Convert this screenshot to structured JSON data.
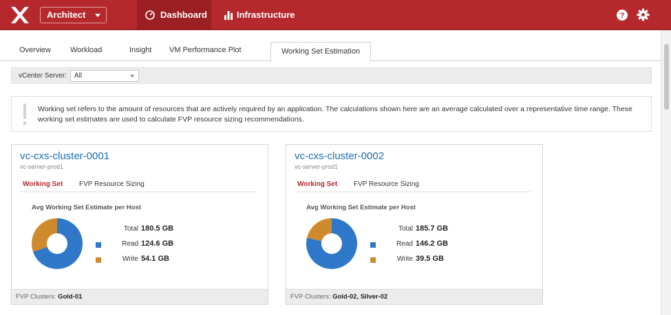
{
  "header": {
    "product": "Architect",
    "nav": [
      {
        "label": "Dashboard",
        "icon": "dashboard-gauge-icon",
        "active": true
      },
      {
        "label": "Infrastructure",
        "icon": "bar-chart-icon",
        "active": false
      }
    ],
    "brand_color": "#b5282c"
  },
  "tabs": [
    {
      "label": "Overview"
    },
    {
      "label": "Workload"
    },
    {
      "label": "Insight"
    },
    {
      "label": "VM Performance Plot"
    },
    {
      "label": "Working Set Estimation",
      "active": true
    }
  ],
  "filter": {
    "label": "vCenter Server:",
    "value": "All"
  },
  "info": {
    "text": "Working set refers to the amount of resources that are actively required by an application. The calculations shown here are an average calculated over a representative time range. These working set estimates are used to calculate FVP resource sizing recommendations."
  },
  "colors": {
    "read": "#2f78c9",
    "write": "#cf8a2e"
  },
  "clusters": [
    {
      "name": "vc-cxs-cluster-0001",
      "server": "vc-server-prod1",
      "tab_active": "Working Set",
      "tab_other": "FVP Resource Sizing",
      "chart_title": "Avg Working Set Estimate per Host",
      "total_label": "Total",
      "total": "180.5 GB",
      "read_label": "Read",
      "read": "124.6 GB",
      "write_label": "Write",
      "write": "54.1 GB",
      "read_gb": 124.6,
      "write_gb": 54.1,
      "footer_label": "FVP Clusters:",
      "footer_value": "Gold-01"
    },
    {
      "name": "vc-cxs-cluster-0002",
      "server": "vc-server-prod1",
      "tab_active": "Working Set",
      "tab_other": "FVP Resource Sizing",
      "chart_title": "Avg Working Set Estimate per Host",
      "total_label": "Total",
      "total": "185.7 GB",
      "read_label": "Read",
      "read": "146.2 GB",
      "write_label": "Write",
      "write": "39.5 GB",
      "read_gb": 146.2,
      "write_gb": 39.5,
      "footer_label": "FVP Clusters:",
      "footer_value": "Gold-02, Silver-02"
    }
  ]
}
